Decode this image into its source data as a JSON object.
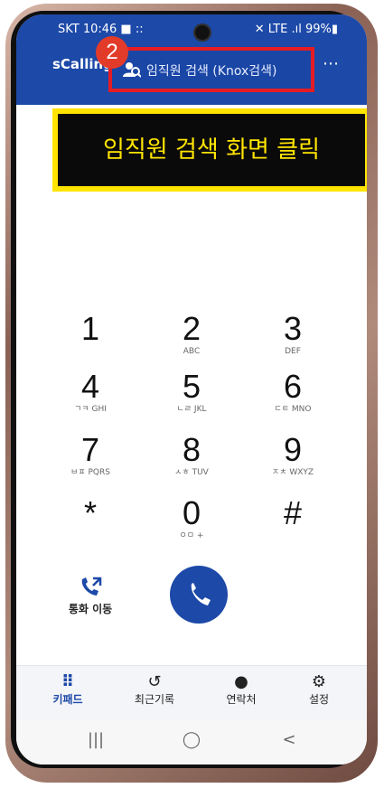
{
  "status_bar": {
    "left": "SKT 10:46 ■ ::",
    "right": "✕ LTE .ıl 99%▮"
  },
  "header": {
    "app_name": "sCalling",
    "search_placeholder": "임직원 검색 (Knox검색)",
    "more": "⋯"
  },
  "annotation": {
    "step": "2",
    "callout": "임직원 검색 화면 클릭"
  },
  "colors": {
    "brand": "#1d49a8",
    "highlight": "#e51c23",
    "callout_text": "#ffe400"
  },
  "dialpad": [
    {
      "digit": "1",
      "sub": ""
    },
    {
      "digit": "2",
      "sub": "ABC"
    },
    {
      "digit": "3",
      "sub": "DEF"
    },
    {
      "digit": "4",
      "sub": "ㄱㅋ GHI"
    },
    {
      "digit": "5",
      "sub": "ㄴㄹ JKL"
    },
    {
      "digit": "6",
      "sub": "ㄷㅌ MNO"
    },
    {
      "digit": "7",
      "sub": "ㅂㅍ PQRS"
    },
    {
      "digit": "8",
      "sub": "ㅅㅎ TUV"
    },
    {
      "digit": "9",
      "sub": "ㅈㅊ WXYZ"
    },
    {
      "digit": "*",
      "sub": ""
    },
    {
      "digit": "0",
      "sub": "ㅇㅁ +"
    },
    {
      "digit": "#",
      "sub": ""
    }
  ],
  "actions": {
    "transfer_label": "통화 이동",
    "call_icon": "phone-icon"
  },
  "tabs": [
    {
      "label": "키패드",
      "icon": "keypad-icon",
      "active": true
    },
    {
      "label": "최근기록",
      "icon": "history-icon",
      "active": false
    },
    {
      "label": "연락처",
      "icon": "person-icon",
      "active": false
    },
    {
      "label": "설정",
      "icon": "gear-icon",
      "active": false
    }
  ],
  "system_nav": {
    "recents": "|||",
    "home": "◯",
    "back": "<"
  }
}
